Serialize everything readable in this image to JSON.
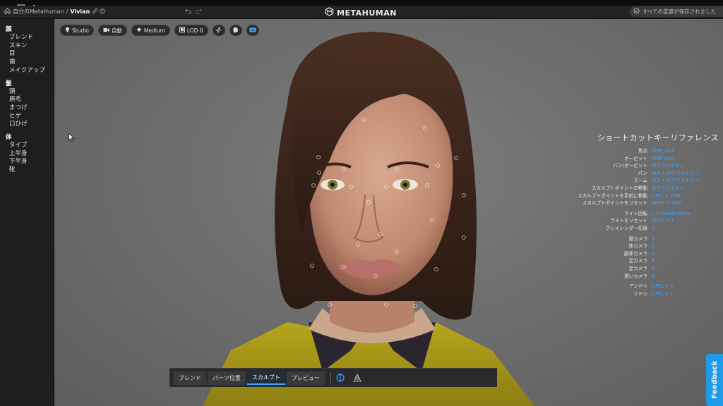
{
  "topbar": {
    "breadcrumb_root": "自分のMetaHuman",
    "breadcrumb_sep": "/",
    "breadcrumb_current": "Vivian",
    "logo_text": "METAHUMAN",
    "saved_status": "すべての変更が保存されました"
  },
  "sidebar": {
    "sections": [
      {
        "title": "顔",
        "items": [
          "ブレンド",
          "スキン",
          "目",
          "歯",
          "メイクアップ"
        ]
      },
      {
        "title": "髪",
        "items": [
          "頭",
          "眉毛",
          "まつげ",
          "ヒゲ",
          "口ひげ"
        ]
      },
      {
        "title": "体",
        "items": [
          "タイプ",
          "上半身",
          "下半身",
          "靴"
        ]
      }
    ]
  },
  "toolbar": {
    "lighting": "Studio",
    "camera": "自動",
    "quality": "Medium",
    "lod": "LOD 0"
  },
  "shortcuts": {
    "title": "ショートカットキーリファレンス",
    "groups": [
      [
        {
          "label": "焦点",
          "key": "RMB Click"
        },
        {
          "label": "オービット",
          "key": "RMB Hold"
        },
        {
          "label": "パン/オービット",
          "key": "中マウスボタン"
        },
        {
          "label": "パン",
          "key": "ALT + 中マウスボタン"
        },
        {
          "label": "ズーム",
          "key": "ALT + 右マウスボタン"
        },
        {
          "label": "スカルプトポイントの移動",
          "key": "左マウスボタン"
        },
        {
          "label": "スカルプトポイントを手前に移動",
          "key": "CTRL + LMB"
        },
        {
          "label": "スカルプトポイントをリセット",
          "key": "SHIFT + LMB"
        }
      ],
      [
        {
          "label": "ライト回転",
          "key": "L + Mouse Move"
        },
        {
          "label": "ライトをリセット",
          "key": "SHIFT + L"
        },
        {
          "label": "クレイレンダー切替",
          "key": "C"
        }
      ],
      [
        {
          "label": "顔カメラ",
          "key": "1"
        },
        {
          "label": "体カメラ",
          "key": "2"
        },
        {
          "label": "胴体カメラ",
          "key": "3"
        },
        {
          "label": "足カメラ",
          "key": "4"
        },
        {
          "label": "足カメラ",
          "key": "5"
        },
        {
          "label": "遠いカメラ",
          "key": "6"
        }
      ],
      [
        {
          "label": "アンドゥ",
          "key": "CTRL + Z"
        },
        {
          "label": "リドゥ",
          "key": "CTRL + Y"
        }
      ]
    ]
  },
  "bottom_tabs": [
    {
      "label": "ブレンド",
      "active": false
    },
    {
      "label": "パーツ位置",
      "active": false
    },
    {
      "label": "スカルプト",
      "active": true
    },
    {
      "label": "プレビュー",
      "active": false
    }
  ],
  "feedback": "Feedback",
  "colors": {
    "accent": "#3fa2ff",
    "feedback": "#1e9be8"
  }
}
